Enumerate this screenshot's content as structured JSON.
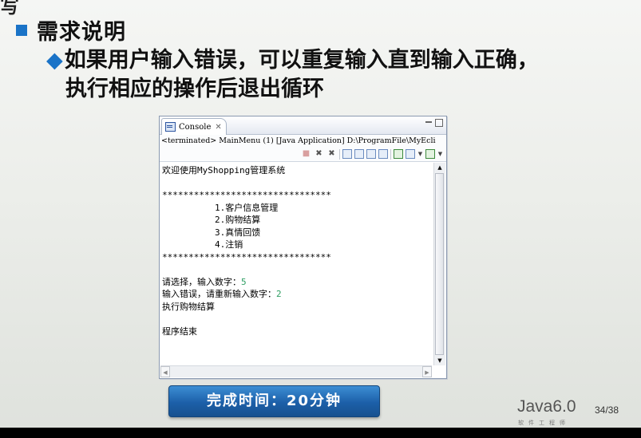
{
  "slide": {
    "top_fragment": "写",
    "heading": "需求说明",
    "bullet_line1": "如果用户输入错误，可以重复输入直到输入正确，",
    "bullet_line2": "执行相应的操作后退出循环",
    "bullet_marker": "◆"
  },
  "console": {
    "tab_label": "Console",
    "tab_close": "✕",
    "status": "<terminated> MainMenu (1) [Java Application] D:\\ProgramFile\\MyEcli",
    "lines": {
      "welcome": "欢迎使用MyShopping管理系统",
      "blank1": "",
      "stars_top": "********************************",
      "menu1": "1.客户信息管理",
      "menu2": "2.购物结算",
      "menu3": "3.真情回馈",
      "menu4": "4.注销",
      "stars_bottom": "********************************",
      "blank2": "",
      "prompt1": "请选择，输入数字：",
      "input1": "5",
      "prompt2": "输入错误，请重新输入数字：",
      "input2": "2",
      "result": "执行购物结算",
      "blank3": "",
      "end": "程序结束"
    },
    "input_color": "#2e9e62"
  },
  "footer": {
    "time_button": "完成时间：20分钟",
    "brand_name": "Java6.0",
    "brand_sub": "软件工程师",
    "page": "34/38"
  },
  "colors": {
    "accent": "#1a73c7",
    "button": "#1c5fa8"
  }
}
